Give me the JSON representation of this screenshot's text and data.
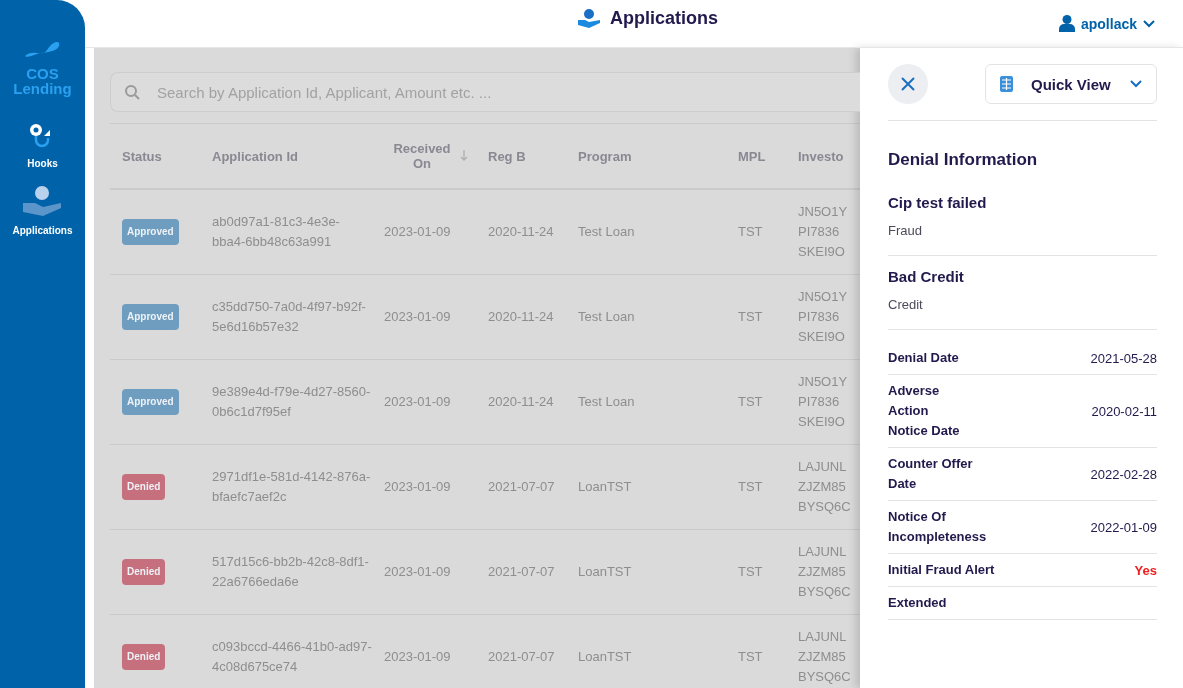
{
  "sidebar": {
    "logo": "COS Lending",
    "items": [
      {
        "label": "Hooks",
        "kind": "hook"
      },
      {
        "label": "Applications",
        "kind": "hand"
      }
    ]
  },
  "header": {
    "title": "Applications",
    "user": "apollack"
  },
  "search": {
    "placeholder": "Search by Application Id, Applicant, Amount etc. ..."
  },
  "table": {
    "columns": [
      {
        "label": "Status",
        "sorted": false
      },
      {
        "label": "Application Id",
        "sorted": false
      },
      {
        "label": "Received On",
        "sorted": true
      },
      {
        "label": "Reg B",
        "sorted": false
      },
      {
        "label": "Program",
        "sorted": false
      },
      {
        "label": "MPL",
        "sorted": false
      },
      {
        "label": "Investo",
        "sorted": false
      }
    ],
    "rows": [
      {
        "status": "Approved",
        "kind": "approved",
        "id": "ab0d97a1-81c3-4e3e-bba4-6bb48c63a991",
        "received": "2023-01-09",
        "reg_b": "2020-11-24",
        "program": "Test Loan",
        "mpl": "TST",
        "investors": [
          "JN5O1Y",
          "PI7836",
          "SKEI9O"
        ]
      },
      {
        "status": "Approved",
        "kind": "approved",
        "id": "c35dd750-7a0d-4f97-b92f-5e6d16b57e32",
        "received": "2023-01-09",
        "reg_b": "2020-11-24",
        "program": "Test Loan",
        "mpl": "TST",
        "investors": [
          "JN5O1Y",
          "PI7836",
          "SKEI9O"
        ]
      },
      {
        "status": "Approved",
        "kind": "approved",
        "id": "9e389e4d-f79e-4d27-8560-0b6c1d7f95ef",
        "received": "2023-01-09",
        "reg_b": "2020-11-24",
        "program": "Test Loan",
        "mpl": "TST",
        "investors": [
          "JN5O1Y",
          "PI7836",
          "SKEI9O"
        ]
      },
      {
        "status": "Denied",
        "kind": "denied",
        "id": "2971df1e-581d-4142-876a-bfaefc7aef2c",
        "received": "2023-01-09",
        "reg_b": "2021-07-07",
        "program": "LoanTST",
        "mpl": "TST",
        "investors": [
          "LAJUNL",
          "ZJZM85",
          "BYSQ6C"
        ]
      },
      {
        "status": "Denied",
        "kind": "denied",
        "id": "517d15c6-bb2b-42c8-8df1-22a6766eda6e",
        "received": "2023-01-09",
        "reg_b": "2021-07-07",
        "program": "LoanTST",
        "mpl": "TST",
        "investors": [
          "LAJUNL",
          "ZJZM85",
          "BYSQ6C"
        ]
      },
      {
        "status": "Denied",
        "kind": "denied",
        "id": "c093bccd-4466-41b0-ad97-4c08d675ce74",
        "received": "2023-01-09",
        "reg_b": "2021-07-07",
        "program": "LoanTST",
        "mpl": "TST",
        "investors": [
          "LAJUNL",
          "ZJZM85",
          "BYSQ6C"
        ]
      }
    ]
  },
  "panel": {
    "view_button": "Quick View",
    "heading": "Denial Information",
    "reasons": [
      {
        "title": "Cip test failed",
        "detail": "Fraud"
      },
      {
        "title": "Bad Credit",
        "detail": "Credit"
      }
    ],
    "fields": [
      {
        "label": "Denial Date",
        "value": "2021-05-28",
        "alert": false
      },
      {
        "label": "Adverse Action Notice Date",
        "value": "2020-02-11",
        "alert": false
      },
      {
        "label": "Counter Offer Date",
        "value": "2022-02-28",
        "alert": false
      },
      {
        "label": "Notice Of Incompleteness",
        "value": "2022-01-09",
        "alert": false
      },
      {
        "label": "Initial Fraud Alert",
        "value": "Yes",
        "alert": true
      },
      {
        "label": "Extended"
      }
    ]
  }
}
